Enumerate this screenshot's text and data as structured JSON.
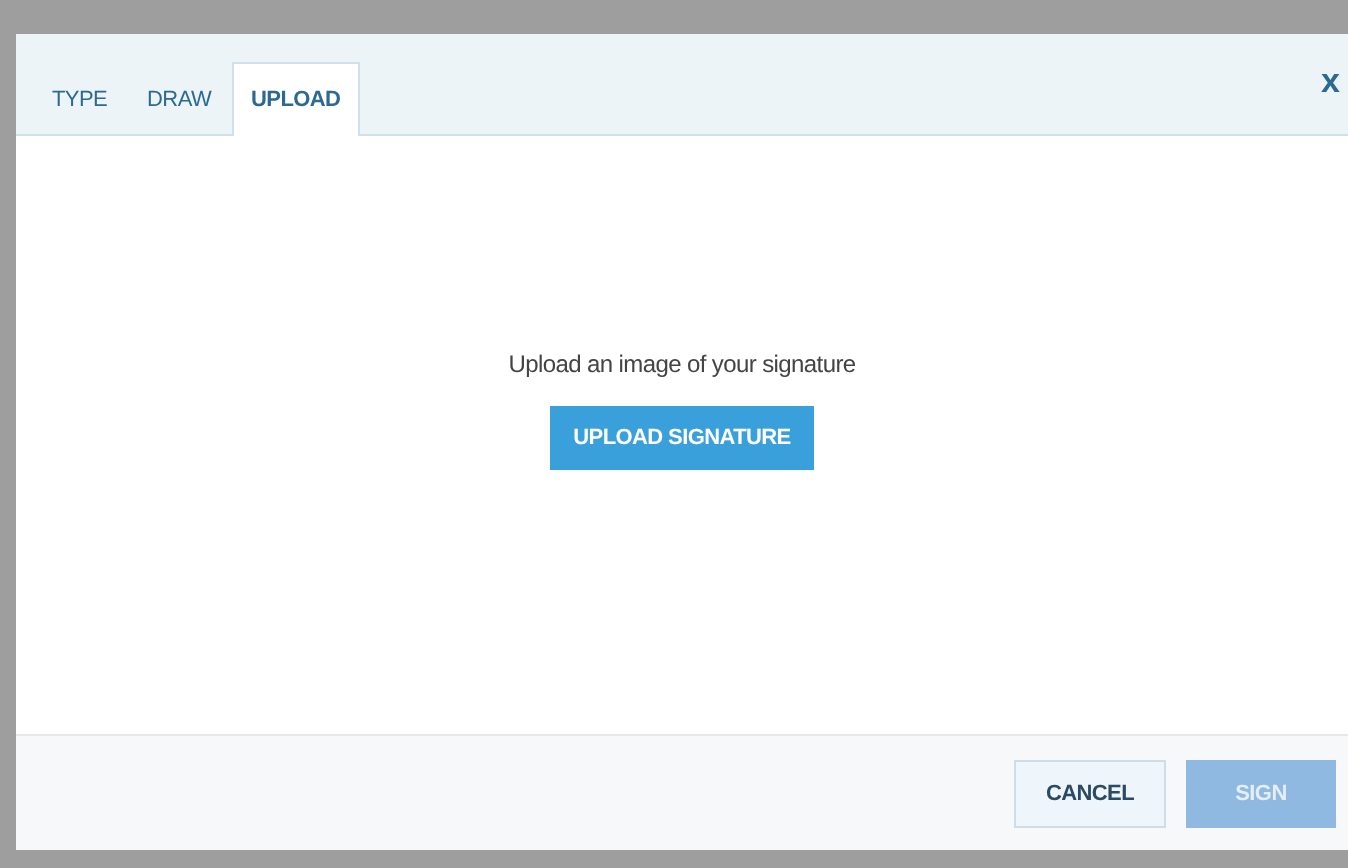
{
  "tabs": [
    {
      "label": "TYPE",
      "selected": false
    },
    {
      "label": "DRAW",
      "selected": false
    },
    {
      "label": "UPLOAD",
      "selected": true
    }
  ],
  "close": "x",
  "body": {
    "prompt": "Upload an image of your signature",
    "upload_button": "UPLOAD SIGNATURE"
  },
  "footer": {
    "buttons": [
      {
        "label": "CANCEL",
        "kind": "secondary",
        "disabled": false
      },
      {
        "label": "SIGN",
        "kind": "primary",
        "disabled": true
      }
    ]
  }
}
